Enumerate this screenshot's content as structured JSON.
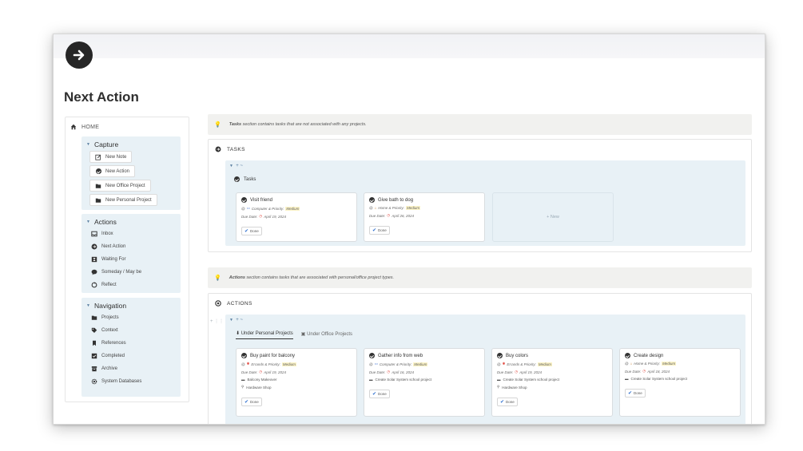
{
  "page": {
    "title": "Next Action",
    "icon": "circle-arrow-right-icon"
  },
  "sidebar": {
    "home_label": "HOME",
    "capture": {
      "title": "Capture",
      "buttons": [
        "New Note",
        "New Action",
        "New Office Project",
        "New Personal Project"
      ]
    },
    "actions": {
      "title": "Actions",
      "items": [
        "Inbox",
        "Next Action",
        "Waiting For",
        "Someday / May be",
        "Reflect"
      ]
    },
    "navigation": {
      "title": "Navigation",
      "items": [
        "Projects",
        "Context",
        "References",
        "Completed",
        "Archive",
        "System Databases"
      ]
    }
  },
  "tasks_callout": {
    "bold": "Tasks",
    "text": " section contains tasks that are not associated with any projects."
  },
  "tasks": {
    "heading": "TASKS",
    "toolbar": "+ ~",
    "view_label": "Tasks",
    "new_label": "+ New",
    "cards": [
      {
        "title": "Visit friend",
        "meta": "Computer & Priority:",
        "priority": "Medium",
        "due": "Due Date: ",
        "date": "April 19, 2024",
        "done": "Done"
      },
      {
        "title": "Give bath to dog",
        "meta": "Home & Priority:",
        "priority": "Medium",
        "due": "Due Date: ",
        "date": "April 26, 2024",
        "done": "Done"
      }
    ]
  },
  "actions_callout": {
    "bold": "Actions",
    "text": " section contains tasks that are associated with personal/office project types."
  },
  "actions_panel": {
    "heading": "ACTIONS",
    "toolbar": "+ ~",
    "tab_personal": "Under Personal Projects",
    "tab_office": "Under Office Projects",
    "cards": [
      {
        "title": "Buy paint for balcony",
        "meta": "Errands & Priority:",
        "priority": "Medium",
        "due": "Due Date: ",
        "date": "April 19, 2024",
        "project": "Balcony Makeover",
        "location": "Hardware Shop",
        "done": "Done"
      },
      {
        "title": "Gather info from web",
        "meta": "Computer & Priority:",
        "priority": "Medium",
        "due": "Due Date: ",
        "date": "April 16, 2024",
        "project": "Create Solar System school project",
        "location": "",
        "done": "Done"
      },
      {
        "title": "Buy colors",
        "meta": "Errands & Priority:",
        "priority": "Medium",
        "due": "Due Date: ",
        "date": "April 19, 2024",
        "project": "Create Solar System school project",
        "location": "Hardware Shop",
        "done": "Done"
      },
      {
        "title": "Create design",
        "meta": "Home & Priority:",
        "priority": "Medium",
        "due": "Due Date: ",
        "date": "April 18, 2024",
        "project": "Create Solar System school project",
        "location": "",
        "done": "Done"
      }
    ]
  },
  "colors": {
    "board_bg": "#e8f1f6",
    "callout_bg": "#f1f1ef",
    "highlight": "#fbf3c7",
    "due_icon": "#e0443b",
    "errands_icon": "#e0443b",
    "check": "#2e6fcf"
  }
}
